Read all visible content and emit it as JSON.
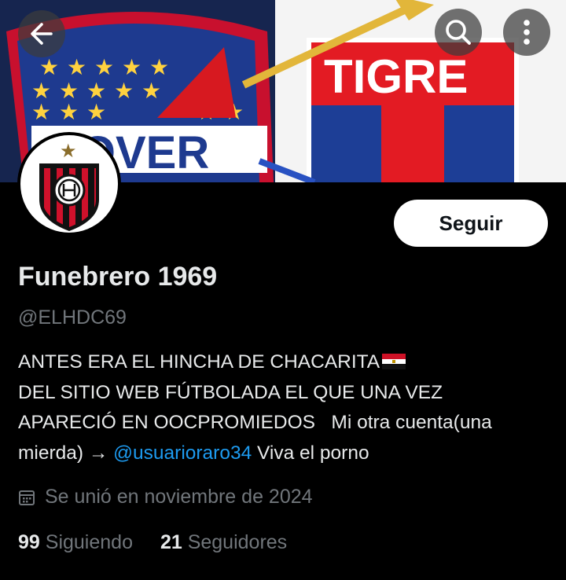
{
  "header": {
    "back_icon": "arrow-left-icon",
    "search_icon": "search-icon",
    "more_icon": "more-vertical-icon"
  },
  "banner": {
    "left_crest_text": "ROVER",
    "right_crest_text": "TIGRE"
  },
  "profile": {
    "follow_label": "Seguir",
    "display_name": "Funebrero 1969",
    "handle": "@ELHDC69",
    "bio": {
      "line1": "ANTES ERA EL HINCHA DE CHACARITA",
      "line2": "DEL SITIO WEB FÚTBOLADA EL QUE UNA VEZ",
      "line3": "APARECIÓ EN OOCPROMIEDOS   Mi otra cuenta(una",
      "line4_prefix": "mierda) → ",
      "mention": "@usuarioraro34",
      "line4_suffix": " Viva el porno"
    },
    "joined": "Se unió en noviembre de 2024",
    "following_count": "99",
    "following_label": "Siguiendo",
    "followers_count": "21",
    "followers_label": "Seguidores"
  },
  "colors": {
    "background": "#000000",
    "link": "#1d9bf0",
    "muted": "#71767b",
    "text": "#e7e9ea"
  }
}
